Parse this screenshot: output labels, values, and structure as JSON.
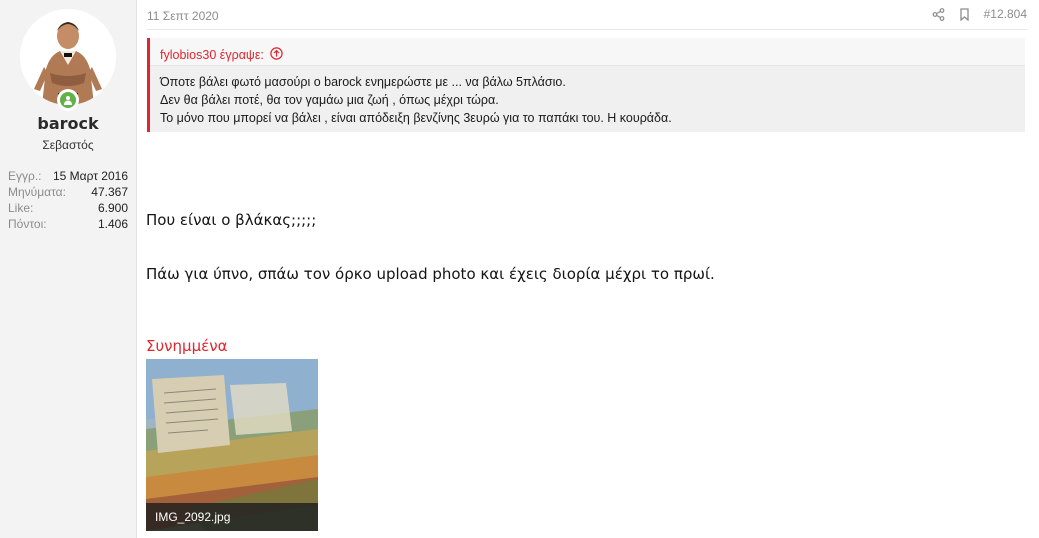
{
  "user": {
    "name": "barock",
    "title": "Σεβαστός",
    "stats": [
      {
        "key": "Εγγρ.:",
        "value": "15 Μαρτ 2016"
      },
      {
        "key": "Μηνύματα:",
        "value": "47.367"
      },
      {
        "key": "Like:",
        "value": "6.900"
      },
      {
        "key": "Πόντοι:",
        "value": "1.406"
      }
    ],
    "online_icon": "user-icon"
  },
  "post": {
    "date": "11 Σεπτ 2020",
    "number": "#12.804",
    "share_icon": "share-icon",
    "bookmark_icon": "bookmark-icon",
    "quote": {
      "author_line": "fylobios30 έγραψε:",
      "jump_icon": "arrow-up-circle-icon",
      "lines": [
        "Όποτε βάλει φωτό μασούρι ο barock ενημερώστε με ... να βάλω 5πλάσιο.",
        "Δεν θα βάλει ποτέ, θα τον γαμάω μια ζωή , όπως μέχρι τώρα.",
        "Το μόνο που μπορεί να βάλει , είναι απόδειξη βενζίνης 3ευρώ για το παπάκι του. Η κουράδα."
      ]
    },
    "message": [
      "Που είναι ο βλάκας;;;;;",
      "Πάω για ύπνο, σπάω τον όρκο upload photo και έχεις διορία μέχρι το πρωί."
    ],
    "attachments_title": "Συνημμένα",
    "attachment": {
      "filename": "IMG_2092.jpg"
    }
  },
  "colors": {
    "accent": "#e0252f",
    "online": "#63b14a",
    "sidebar_bg": "#f3f3f3",
    "quote_bg": "#f0f0f0"
  }
}
